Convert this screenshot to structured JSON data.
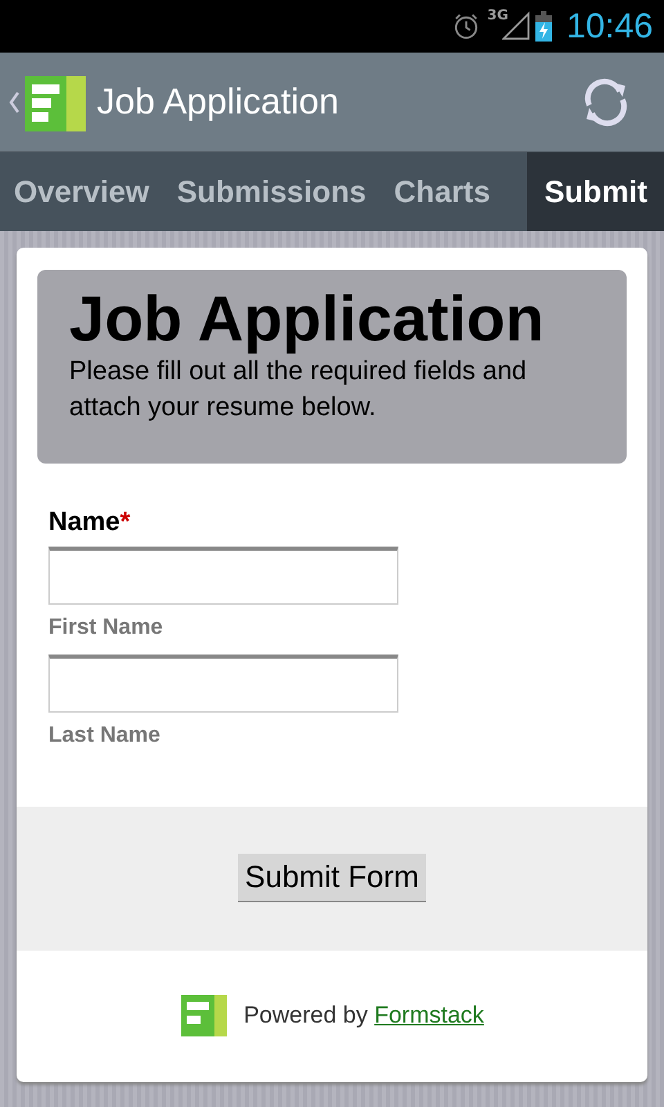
{
  "status_bar": {
    "network": "3G",
    "time": "10:46"
  },
  "action_bar": {
    "title": "Job Application"
  },
  "tabs": [
    {
      "label": "Overview",
      "selected": false
    },
    {
      "label": "Submissions",
      "selected": false
    },
    {
      "label": "Charts",
      "selected": false
    },
    {
      "label": "Submit",
      "selected": true
    }
  ],
  "form": {
    "title": "Job Application",
    "description": "Please fill out all the required fields and attach your resume below.",
    "field": {
      "label": "Name",
      "required_mark": "*",
      "subfields": [
        {
          "caption": "First Name"
        },
        {
          "caption": "Last Name"
        }
      ]
    },
    "submit_button": "Submit Form",
    "footer": {
      "text": "Powered by",
      "link": "Formstack"
    }
  }
}
